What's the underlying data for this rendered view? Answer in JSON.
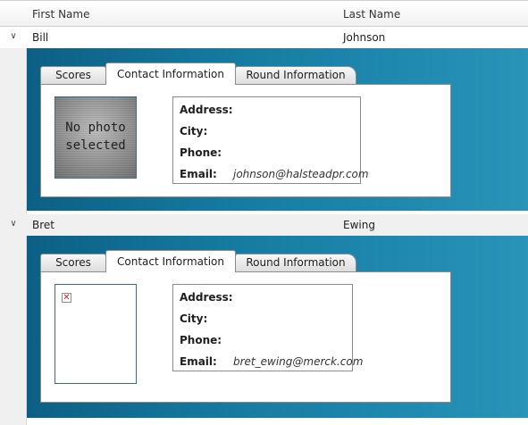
{
  "grid": {
    "columns": [
      {
        "label": "First Name"
      },
      {
        "label": "Last Name"
      }
    ],
    "rows": [
      {
        "first_name": "Bill",
        "last_name": "Johnson",
        "expander_icon": "chevron-down",
        "tabs": [
          "Scores",
          "Contact Information",
          "Round Information"
        ],
        "active_tab": "Contact Information",
        "photo_text": "No photo selected",
        "contact": {
          "address_label": "Address:",
          "city_label": "City:",
          "phone_label": "Phone:",
          "email_label": "Email:",
          "email": "johnson@halsteadpr.com"
        }
      },
      {
        "first_name": "Bret",
        "last_name": "Ewing",
        "expander_icon": "chevron-down",
        "tabs": [
          "Scores",
          "Contact Information",
          "Round Information"
        ],
        "active_tab": "Contact Information",
        "photo_icon": "broken-image",
        "contact": {
          "address_label": "Address:",
          "city_label": "City:",
          "phone_label": "Phone:",
          "email_label": "Email:",
          "email": "bret_ewing@merck.com"
        }
      }
    ]
  },
  "colors": {
    "detail_gradient_start": "#0c5f84",
    "detail_gradient_end": "#2a93b8",
    "broken_icon_red": "#d41f1f"
  }
}
